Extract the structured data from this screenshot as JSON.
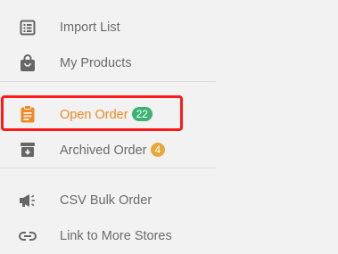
{
  "colors": {
    "background": "#f2f2f2",
    "text": "#6b6b6b",
    "icon": "#666666",
    "active": "#f08a24",
    "badge_green": "#3cb371",
    "badge_yellow": "#e8a93b",
    "highlight": "#ff1a1a",
    "divider": "#dddddd"
  },
  "sidebar": {
    "items": [
      {
        "label": "Import List",
        "icon": "list-icon"
      },
      {
        "label": "My Products",
        "icon": "shopping-bag-icon"
      },
      {
        "label": "Open Order",
        "icon": "clipboard-icon",
        "badge": "22",
        "active": true
      },
      {
        "label": "Archived Order",
        "icon": "archive-box-icon",
        "badge": "4"
      },
      {
        "label": "CSV Bulk Order",
        "icon": "megaphone-icon"
      },
      {
        "label": "Link to More Stores",
        "icon": "link-icon"
      }
    ]
  }
}
